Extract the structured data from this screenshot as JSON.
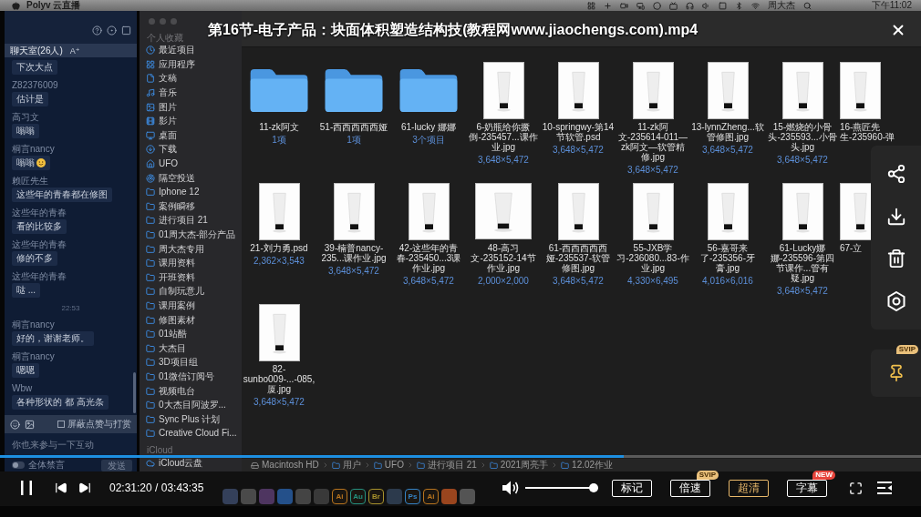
{
  "menu_bar": {
    "app_name": "Polyv 云直播",
    "user": "周大杰",
    "clock": "下午11:02"
  },
  "chat": {
    "room_title": "聊天室(26人)",
    "font_size_button": "A⁺",
    "messages": [
      {
        "kind": "message",
        "text": "下次大点",
        "emoji": false
      },
      {
        "kind": "message",
        "name": "Z82376009",
        "text": "估计是",
        "emoji": false
      },
      {
        "kind": "message",
        "name": "高习文",
        "text": "嗡嗡",
        "emoji": false
      },
      {
        "kind": "message",
        "name": "桐言nancy",
        "text": "嗡嗡",
        "emoji": true
      },
      {
        "kind": "message",
        "name": "赖匠先生",
        "text": "这些年的青春都在修图",
        "emoji": false
      },
      {
        "kind": "message",
        "name": "这些年的青春",
        "text": "看的比较多",
        "emoji": false
      },
      {
        "kind": "message",
        "name": "这些年的青春",
        "text": "修的不多",
        "emoji": false
      },
      {
        "kind": "message",
        "name": "这些年的青春",
        "text": "哒 ...",
        "emoji": false
      },
      {
        "kind": "time",
        "text": "22:53"
      },
      {
        "kind": "message",
        "name": "桐言nancy",
        "text": "好的，谢谢老师。",
        "emoji": false
      },
      {
        "kind": "message",
        "name": "桐言nancy",
        "text": "嗯嗯",
        "emoji": false
      },
      {
        "kind": "message",
        "name": "Wbw",
        "text": "各种形状的 都 高光条",
        "emoji": false
      }
    ],
    "block_gifts": {
      "label": "屏蔽点赞与打赏",
      "checked": false
    },
    "input": {
      "placeholder": "你也来参与一下互动"
    },
    "mute_all": {
      "label": "全体禁言",
      "on": false
    },
    "send_button": "发送"
  },
  "finder": {
    "sidebar": {
      "sections": [
        {
          "title": "个人收藏",
          "items": [
            {
              "label": "最近项目",
              "kind": "recents"
            },
            {
              "label": "应用程序",
              "kind": "applications"
            },
            {
              "label": "文稿",
              "kind": "documents"
            },
            {
              "label": "音乐",
              "kind": "music"
            },
            {
              "label": "图片",
              "kind": "pictures"
            },
            {
              "label": "影片",
              "kind": "movies"
            },
            {
              "label": "桌面",
              "kind": "desktop"
            },
            {
              "label": "下载",
              "kind": "downloads"
            },
            {
              "label": "UFO",
              "kind": "home"
            },
            {
              "label": "隔空投送",
              "kind": "airdrop"
            },
            {
              "label": "Iphone 12",
              "kind": "folder"
            },
            {
              "label": "案例瞬移",
              "kind": "folder"
            },
            {
              "label": "进行项目 21",
              "kind": "folder"
            },
            {
              "label": "01周大杰-部分产品",
              "kind": "folder"
            },
            {
              "label": "周大杰专用",
              "kind": "folder"
            },
            {
              "label": "课用资料",
              "kind": "folder"
            },
            {
              "label": "开班资料",
              "kind": "folder"
            },
            {
              "label": "自制玩意儿",
              "kind": "folder"
            },
            {
              "label": "课用案例",
              "kind": "folder"
            },
            {
              "label": "修图素材",
              "kind": "folder"
            },
            {
              "label": "01站酷",
              "kind": "folder"
            },
            {
              "label": "大杰目",
              "kind": "folder"
            },
            {
              "label": "3D项目组",
              "kind": "folder"
            },
            {
              "label": "01微信订阅号",
              "kind": "folder"
            },
            {
              "label": "视频电台",
              "kind": "folder"
            },
            {
              "label": "0大杰目阿波罗...",
              "kind": "folder"
            },
            {
              "label": "Sync Plus 计划",
              "kind": "folder"
            },
            {
              "label": "Creative Cloud Fi...",
              "kind": "folder"
            }
          ]
        },
        {
          "title": "iCloud",
          "items": [
            {
              "label": "iCloud云盘",
              "kind": "cloud"
            }
          ]
        }
      ]
    },
    "items": [
      {
        "kind": "folder",
        "name": "11-zk阿文",
        "meta": "1项"
      },
      {
        "kind": "folder",
        "name": "51-西西西西西娅",
        "meta": "1项"
      },
      {
        "kind": "folder",
        "name": "61-lucky 娜娜",
        "meta": "3个项目"
      },
      {
        "kind": "portrait",
        "name": "6-奶瓶给你撅倒-235457...课作业.jpg",
        "meta": "3,648×5,472"
      },
      {
        "kind": "portrait",
        "name": "10-springwy-第14节软管.psd",
        "meta": "3,648×5,472"
      },
      {
        "kind": "portrait",
        "name": "11-zk阿文-235614-011—zk阿文—软管精修.jpg",
        "meta": "3,648×5,472"
      },
      {
        "kind": "portrait",
        "name": "13-lynnZheng...软管修图.jpg",
        "meta": "3,648×5,472"
      },
      {
        "kind": "portrait",
        "name": "15-燃烧的小骨头-235593...小骨头.jpg",
        "meta": "3,648×5,472"
      },
      {
        "kind": "portrait",
        "name": "16-燕匠先生-235960-弹"
      },
      {
        "kind": "portrait",
        "name": "21-刘力勇.psd",
        "meta": "2,362×3,543"
      },
      {
        "kind": "portrait",
        "name": "39-楠普nancy-235...课作业.jpg",
        "meta": "3,648×5,472"
      },
      {
        "kind": "portrait",
        "name": "42-这些年的青春-235450...3课作业.jpg",
        "meta": "3,648×5,472"
      },
      {
        "kind": "square",
        "name": "48-高习文-235152-14节作业.jpg",
        "meta": "2,000×2,000"
      },
      {
        "kind": "portrait",
        "name": "61-西西西西西娅-235537-软管修图.jpg",
        "meta": "3,648×5,472"
      },
      {
        "kind": "portrait",
        "name": "55-JXB学习-236080...83-作业.jpg",
        "meta": "4,330×6,495"
      },
      {
        "kind": "portrait",
        "name": "56-嘉哥来了-235356-牙膏.jpg",
        "meta": "4,016×6,016"
      },
      {
        "kind": "portrait",
        "name": "61-Lucky娜娜-235596-第四节课作...管有疑.jpg",
        "meta": "3,648×5,472"
      },
      {
        "kind": "portrait",
        "name": "67-立"
      },
      {
        "kind": "portrait",
        "name": "82-sunbo009-...-085,厦.jpg",
        "meta": "3,648×5,472"
      }
    ],
    "path": [
      {
        "label": "Macintosh HD",
        "kind": "disk"
      },
      {
        "label": "用户",
        "kind": "folder"
      },
      {
        "label": "UFO",
        "kind": "folder"
      },
      {
        "label": "进行项目 21",
        "kind": "folder"
      },
      {
        "label": "2021周亮手",
        "kind": "folder"
      },
      {
        "label": "12.02作业",
        "kind": "folder"
      }
    ]
  },
  "dock": [
    {
      "color": "#34405a"
    },
    {
      "color": "#4a4a4a"
    },
    {
      "color": "#4e3560"
    },
    {
      "color": "#24508a"
    },
    {
      "color": "#444444"
    },
    {
      "color": "#393939"
    },
    {
      "label": "Ai",
      "color": "#b8741e"
    },
    {
      "label": "Au",
      "color": "#25917f"
    },
    {
      "label": "Br",
      "color": "#a8922c"
    },
    {
      "color": "#2c3a4c"
    },
    {
      "label": "Ps",
      "color": "#3583c6"
    },
    {
      "label": "Ai",
      "color": "#b8741e"
    },
    {
      "color": "#9a451e"
    },
    {
      "color": "#545454"
    }
  ],
  "player": {
    "title": "第16节-电子产品：块面体积塑造结构技(教程网www.jiaochengs.com).mp4",
    "progress": {
      "level": 0.677
    },
    "time": "02:31:20 / 03:43:35",
    "volume": {
      "level": 1.0
    },
    "buttons": [
      {
        "label": "标记",
        "highlighted": false
      },
      {
        "label": "倍速",
        "highlighted": false,
        "badge": {
          "text": "SVIP",
          "color": "#e9c07b"
        }
      },
      {
        "label": "超清",
        "highlighted": true
      },
      {
        "label": "字幕",
        "highlighted": false,
        "badge": {
          "text": "NEW",
          "color": "#e8453c"
        }
      }
    ],
    "pin_badge": "SVIP"
  }
}
